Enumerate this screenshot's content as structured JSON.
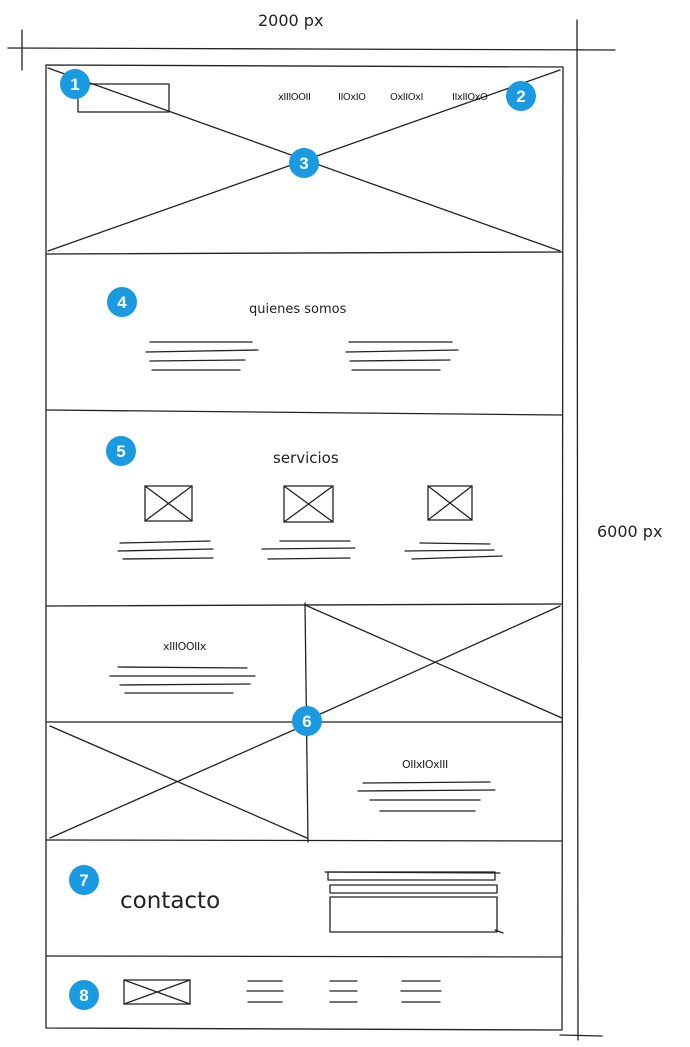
{
  "dimensions": {
    "width_label": "2000 px",
    "height_label": "6000 px"
  },
  "header": {
    "nav_items": [
      "xIIIOOII",
      "IIOxIO",
      "OxIIOxI",
      "IIxIIOxO"
    ]
  },
  "about": {
    "title": "quienes somos"
  },
  "services": {
    "title": "servicios"
  },
  "features": {
    "block1_title": "xIIIOOIIx",
    "block2_title": "OIIxIOxIII"
  },
  "contact": {
    "title": "contacto"
  },
  "markers": [
    "1",
    "2",
    "3",
    "4",
    "5",
    "6",
    "7",
    "8"
  ],
  "colors": {
    "marker": "#1a9ae0",
    "ink": "#222222"
  }
}
